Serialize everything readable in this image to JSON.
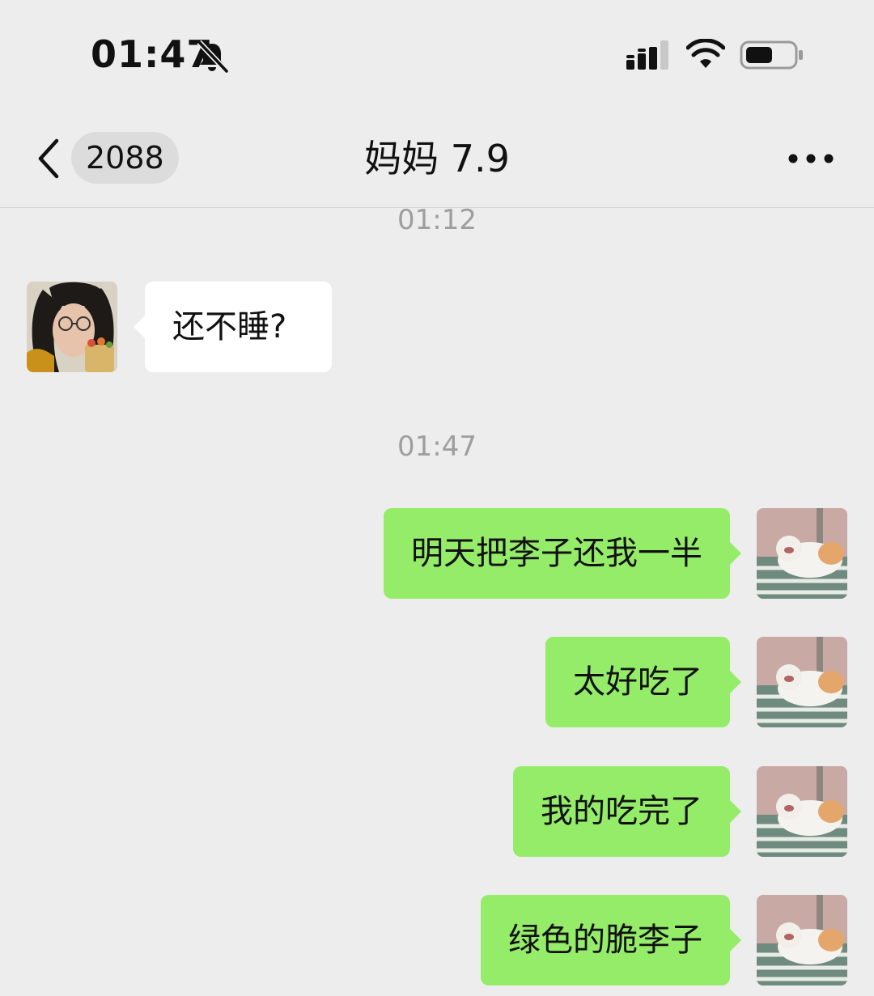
{
  "status_bar": {
    "time": "01:47",
    "icons": [
      "bell-slash-icon",
      "cellular-signal-icon",
      "wifi-icon",
      "battery-icon"
    ]
  },
  "nav": {
    "back_icon": "chevron-left-icon",
    "unread_count": "2088",
    "title": "妈妈 7.9",
    "more_icon": "ellipsis-icon"
  },
  "messages": {
    "time_1": "01:12",
    "received_1": "还不睡?",
    "time_2": "01:47",
    "sent_1": "明天把李子还我一半",
    "sent_2": "太好吃了",
    "sent_3": "我的吃完了",
    "sent_4": "绿色的脆李子"
  },
  "colors": {
    "background": "#ededed",
    "sent_bubble": "#95ec69",
    "received_bubble": "#ffffff",
    "timestamp": "#9e9e9e"
  }
}
